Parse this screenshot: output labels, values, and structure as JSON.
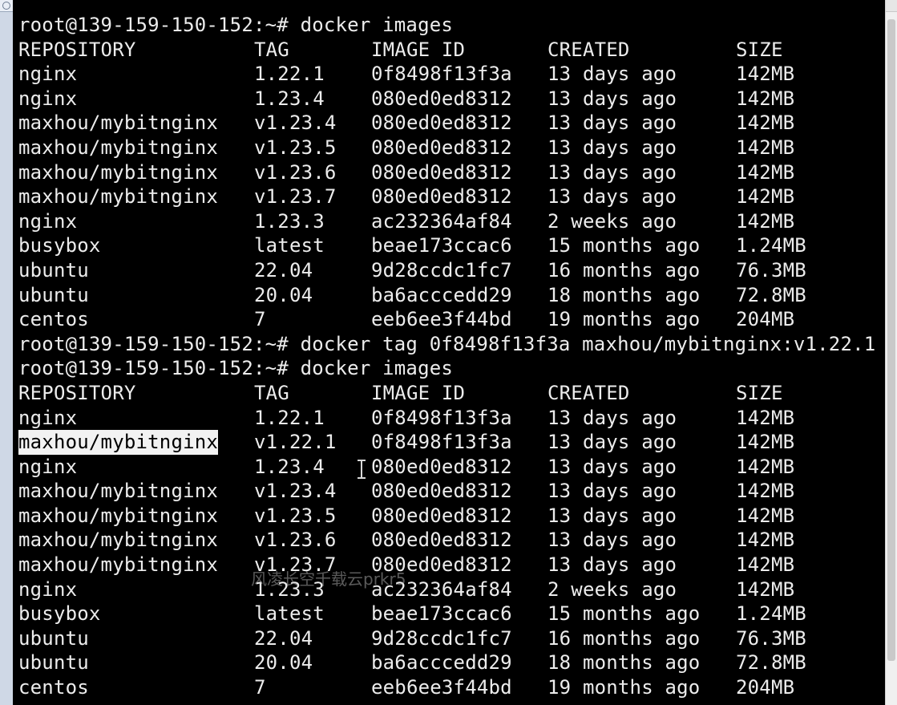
{
  "terminal": {
    "lines": [
      {
        "type": "prompt",
        "text": "root@139-159-150-152:~# docker images"
      },
      {
        "type": "row",
        "cells": [
          "REPOSITORY",
          "TAG",
          "IMAGE ID",
          "CREATED",
          "SIZE"
        ]
      },
      {
        "type": "row",
        "cells": [
          "nginx",
          "1.22.1",
          "0f8498f13f3a",
          "13 days ago",
          "142MB"
        ]
      },
      {
        "type": "row",
        "cells": [
          "nginx",
          "1.23.4",
          "080ed0ed8312",
          "13 days ago",
          "142MB"
        ]
      },
      {
        "type": "row",
        "cells": [
          "maxhou/mybitnginx",
          "v1.23.4",
          "080ed0ed8312",
          "13 days ago",
          "142MB"
        ]
      },
      {
        "type": "row",
        "cells": [
          "maxhou/mybitnginx",
          "v1.23.5",
          "080ed0ed8312",
          "13 days ago",
          "142MB"
        ]
      },
      {
        "type": "row",
        "cells": [
          "maxhou/mybitnginx",
          "v1.23.6",
          "080ed0ed8312",
          "13 days ago",
          "142MB"
        ]
      },
      {
        "type": "row",
        "cells": [
          "maxhou/mybitnginx",
          "v1.23.7",
          "080ed0ed8312",
          "13 days ago",
          "142MB"
        ]
      },
      {
        "type": "row",
        "cells": [
          "nginx",
          "1.23.3",
          "ac232364af84",
          "2 weeks ago",
          "142MB"
        ]
      },
      {
        "type": "row",
        "cells": [
          "busybox",
          "latest",
          "beae173ccac6",
          "15 months ago",
          "1.24MB"
        ]
      },
      {
        "type": "row",
        "cells": [
          "ubuntu",
          "22.04",
          "9d28ccdc1fc7",
          "16 months ago",
          "76.3MB"
        ]
      },
      {
        "type": "row",
        "cells": [
          "ubuntu",
          "20.04",
          "ba6acccedd29",
          "18 months ago",
          "72.8MB"
        ]
      },
      {
        "type": "row",
        "cells": [
          "centos",
          "7",
          "eeb6ee3f44bd",
          "19 months ago",
          "204MB"
        ]
      },
      {
        "type": "prompt",
        "text": "root@139-159-150-152:~# docker tag 0f8498f13f3a maxhou/mybitnginx:v1.22.1"
      },
      {
        "type": "prompt",
        "text": "root@139-159-150-152:~# docker images"
      },
      {
        "type": "row",
        "cells": [
          "REPOSITORY",
          "TAG",
          "IMAGE ID",
          "CREATED",
          "SIZE"
        ]
      },
      {
        "type": "row",
        "cells": [
          "nginx",
          "1.22.1",
          "0f8498f13f3a",
          "13 days ago",
          "142MB"
        ]
      },
      {
        "type": "row",
        "cells": [
          "maxhou/mybitnginx",
          "v1.22.1",
          "0f8498f13f3a",
          "13 days ago",
          "142MB"
        ],
        "highlight_first": true
      },
      {
        "type": "row",
        "cells": [
          "nginx",
          "1.23.4",
          "080ed0ed8312",
          "13 days ago",
          "142MB"
        ]
      },
      {
        "type": "row",
        "cells": [
          "maxhou/mybitnginx",
          "v1.23.4",
          "080ed0ed8312",
          "13 days ago",
          "142MB"
        ]
      },
      {
        "type": "row",
        "cells": [
          "maxhou/mybitnginx",
          "v1.23.5",
          "080ed0ed8312",
          "13 days ago",
          "142MB"
        ]
      },
      {
        "type": "row",
        "cells": [
          "maxhou/mybitnginx",
          "v1.23.6",
          "080ed0ed8312",
          "13 days ago",
          "142MB"
        ]
      },
      {
        "type": "row",
        "cells": [
          "maxhou/mybitnginx",
          "v1.23.7",
          "080ed0ed8312",
          "13 days ago",
          "142MB"
        ]
      },
      {
        "type": "row",
        "cells": [
          "nginx",
          "1.23.3",
          "ac232364af84",
          "2 weeks ago",
          "142MB"
        ]
      },
      {
        "type": "row",
        "cells": [
          "busybox",
          "latest",
          "beae173ccac6",
          "15 months ago",
          "1.24MB"
        ]
      },
      {
        "type": "row",
        "cells": [
          "ubuntu",
          "22.04",
          "9d28ccdc1fc7",
          "16 months ago",
          "76.3MB"
        ]
      },
      {
        "type": "row",
        "cells": [
          "ubuntu",
          "20.04",
          "ba6acccedd29",
          "18 months ago",
          "72.8MB"
        ]
      },
      {
        "type": "row",
        "cells": [
          "centos",
          "7",
          "eeb6ee3f44bd",
          "19 months ago",
          "204MB"
        ]
      }
    ]
  },
  "watermark": {
    "text": "风凌长空千载云prkr5"
  },
  "colors": {
    "background": "#000000",
    "foreground": "#ececec",
    "selection_bg": "#f2f2f2",
    "selection_fg": "#000000"
  },
  "icons": {
    "cursor": "text-cursor-icon"
  }
}
